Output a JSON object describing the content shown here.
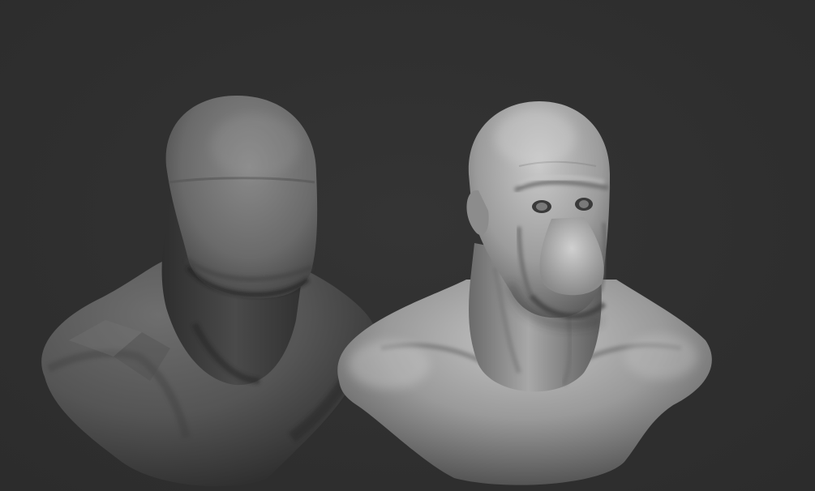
{
  "viewport": {
    "background_color": "#2f2f2f"
  },
  "models": [
    {
      "id": "blockout-bust",
      "description_icon": "faceted-blockout-bust",
      "material_color": "#5a5a5a"
    },
    {
      "id": "sculpted-bust",
      "description_icon": "sculpted-character-bust",
      "material_color": "#8a8a8a"
    }
  ]
}
